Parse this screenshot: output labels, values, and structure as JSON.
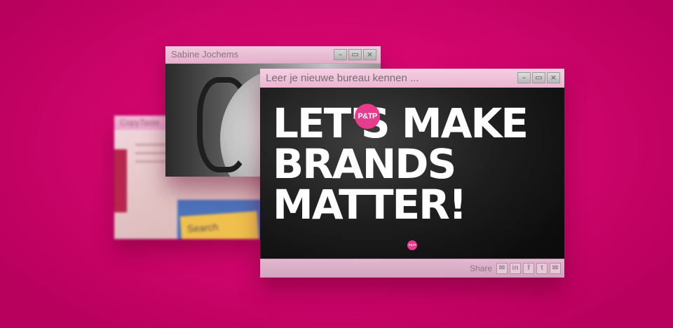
{
  "windows": {
    "back": {
      "title": "CopyTaste",
      "search_text": "Search"
    },
    "middle": {
      "title": "Sabine Jochems"
    },
    "front": {
      "title": "Leer je nieuwe bureau kennen ...",
      "headline": [
        "LET'S MAKE",
        "BRANDS",
        "MATTER!"
      ],
      "logo_text": "P&TP",
      "share_label": "Share",
      "share_icons": [
        {
          "name": "email-icon",
          "glyph": "✉"
        },
        {
          "name": "linkedin-icon",
          "glyph": "in"
        },
        {
          "name": "facebook-icon",
          "glyph": "f"
        },
        {
          "name": "twitter-icon",
          "glyph": "t"
        },
        {
          "name": "mail-icon",
          "glyph": "✉"
        }
      ]
    },
    "controls": {
      "minimize": "–",
      "restore": "▭",
      "close": "×"
    }
  },
  "colors": {
    "background": "#d5066f",
    "accent": "#e83b8e",
    "titlebar": "#f6cfe3"
  }
}
